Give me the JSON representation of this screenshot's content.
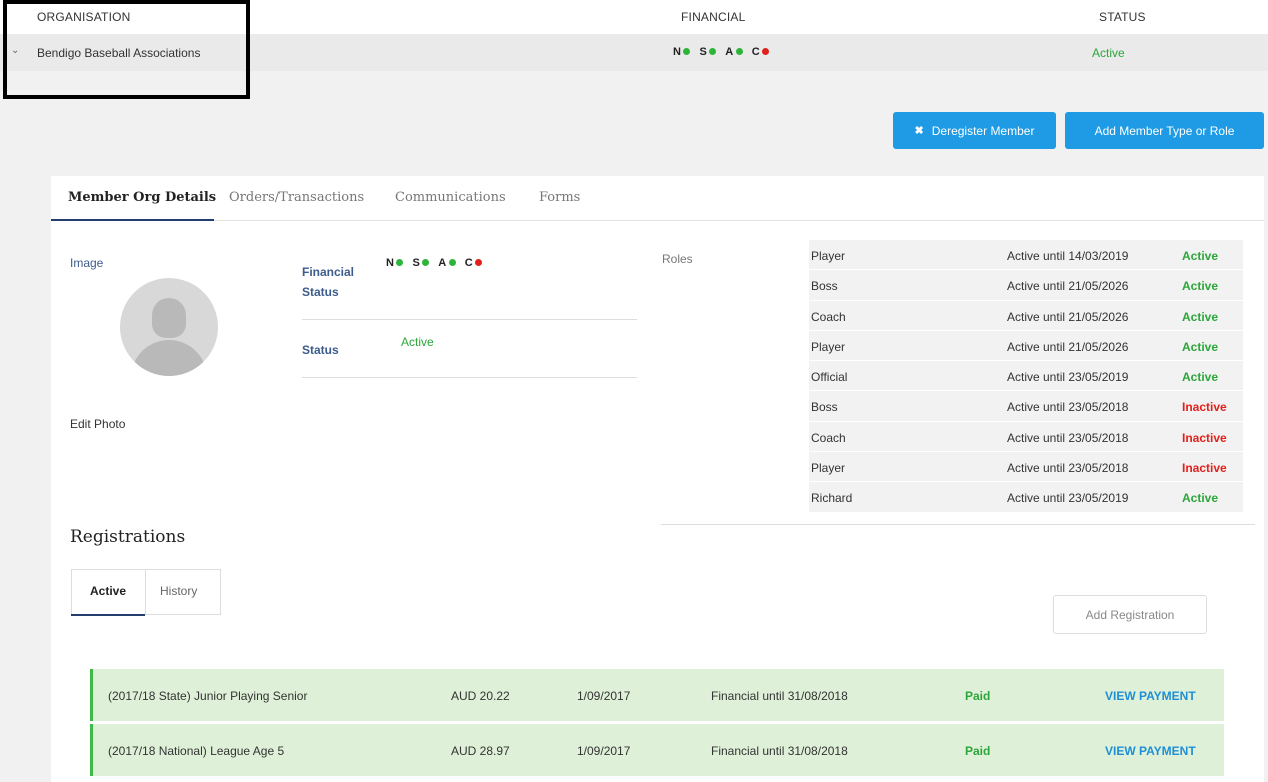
{
  "table_header": {
    "organisation": "ORGANISATION",
    "financial": "FINANCIAL",
    "status": "STATUS"
  },
  "org_row": {
    "name": "Bendigo Baseball Associations",
    "financial": [
      {
        "letter": "N",
        "color": "#2db53a"
      },
      {
        "letter": "S",
        "color": "#2db53a"
      },
      {
        "letter": "A",
        "color": "#2db53a"
      },
      {
        "letter": "C",
        "color": "#e0211b"
      }
    ],
    "status": "Active"
  },
  "buttons": {
    "deregister": "Deregister Member",
    "add_member_type": "Add Member Type or Role"
  },
  "tabs": [
    "Member Org Details",
    "Orders/Transactions",
    "Communications",
    "Forms"
  ],
  "details": {
    "image_label": "Image",
    "edit_photo": "Edit Photo",
    "financial_status_label": "Financial Status",
    "status_label": "Status",
    "status_value": "Active"
  },
  "roles": {
    "label": "Roles",
    "items": [
      {
        "role": "Player",
        "until": "Active until 14/03/2019",
        "status": "Active"
      },
      {
        "role": "Boss",
        "until": "Active until 21/05/2026",
        "status": "Active"
      },
      {
        "role": "Coach",
        "until": "Active until 21/05/2026",
        "status": "Active"
      },
      {
        "role": "Player",
        "until": "Active until 21/05/2026",
        "status": "Active"
      },
      {
        "role": "Official",
        "until": "Active until 23/05/2019",
        "status": "Active"
      },
      {
        "role": "Boss",
        "until": "Active until 23/05/2018",
        "status": "Inactive"
      },
      {
        "role": "Coach",
        "until": "Active until 23/05/2018",
        "status": "Inactive"
      },
      {
        "role": "Player",
        "until": "Active until 23/05/2018",
        "status": "Inactive"
      },
      {
        "role": "Richard",
        "until": "Active until 23/05/2019",
        "status": "Active"
      }
    ]
  },
  "registrations": {
    "title": "Registrations",
    "tab_active": "Active",
    "tab_history": "History",
    "add_button": "Add Registration",
    "rows": [
      {
        "name": "(2017/18 State) Junior Playing Senior",
        "amount": "AUD 20.22",
        "date": "1/09/2017",
        "financial": "Financial until 31/08/2018",
        "status": "Paid",
        "action": "VIEW PAYMENT"
      },
      {
        "name": "(2017/18 National) League Age 5",
        "amount": "AUD 28.97",
        "date": "1/09/2017",
        "financial": "Financial until 31/08/2018",
        "status": "Paid",
        "action": "VIEW PAYMENT"
      }
    ]
  }
}
